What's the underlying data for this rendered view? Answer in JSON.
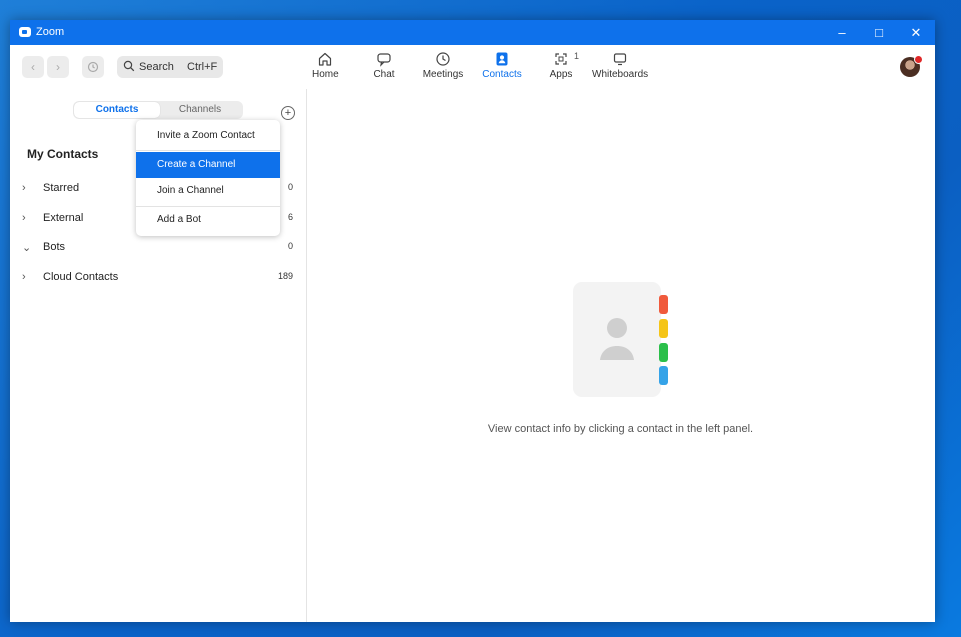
{
  "window": {
    "title": "Zoom"
  },
  "search": {
    "label": "Search",
    "shortcut": "Ctrl+F"
  },
  "nav": {
    "home": "Home",
    "chat": "Chat",
    "meetings": "Meetings",
    "contacts": "Contacts",
    "apps": "Apps",
    "apps_badge": "1",
    "whiteboards": "Whiteboards",
    "active": "Contacts"
  },
  "tabs": {
    "contacts": "Contacts",
    "channels": "Channels"
  },
  "contacts": {
    "heading": "My Contacts",
    "groups": [
      {
        "label": "Starred",
        "count": "0",
        "expanded": false
      },
      {
        "label": "External",
        "count": "6",
        "expanded": false
      },
      {
        "label": "Bots",
        "count": "0",
        "expanded": true
      },
      {
        "label": "Cloud Contacts",
        "count": "189",
        "expanded": false
      }
    ]
  },
  "menu": {
    "items": [
      {
        "label": "Invite a Zoom Contact"
      },
      {
        "label": "Create a Channel",
        "highlighted": true
      },
      {
        "label": "Join a Channel"
      },
      {
        "label": "Add a Bot"
      }
    ]
  },
  "empty_state": {
    "text": "View contact info by clicking a contact in the left panel."
  },
  "colors": {
    "accent": "#0e71eb",
    "tab_red": "#f05a3c",
    "tab_yellow": "#f5c518",
    "tab_green": "#2bbf4a",
    "tab_blue": "#35a3e8"
  }
}
